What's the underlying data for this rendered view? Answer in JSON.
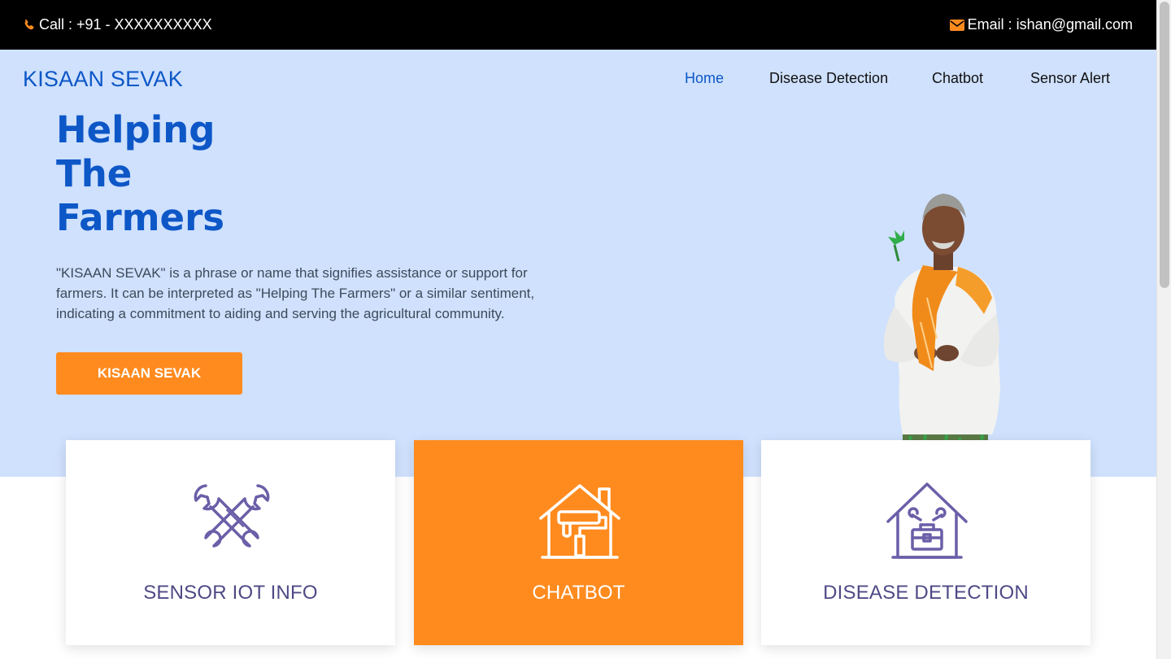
{
  "topbar": {
    "call_text": "Call : +91 - XXXXXXXXXX",
    "email_text": "Email : ishan@gmail.com",
    "phone_icon": "phone-icon",
    "mail_icon": "envelope-icon",
    "icon_color": "#ff8b1f"
  },
  "brand": "KISAAN SEVAK",
  "nav": {
    "items": [
      "Home",
      "Disease Detection",
      "Chatbot",
      "Sensor Alert"
    ],
    "active": "Home"
  },
  "hero": {
    "headline": [
      "Helping",
      "The",
      "Farmers"
    ],
    "description": "\"KISAAN SEVAK\" is a phrase or name that signifies assistance or support for farmers. It can be interpreted as \"Helping The Farmers\" or a similar sentiment, indicating a commitment to aiding and serving the agricultural community.",
    "cta_label": "KISAAN SEVAK"
  },
  "cards": [
    {
      "label": "SENSOR IOT INFO",
      "icon": "crossed-wrenches-icon"
    },
    {
      "label": "CHATBOT",
      "icon": "house-paint-roller-icon"
    },
    {
      "label": "DISEASE DETECTION",
      "icon": "house-toolbox-icon"
    }
  ],
  "colors": {
    "brand_blue": "#0d57c7",
    "hero_bg": "#cfe1fd",
    "accent_orange": "#ff8b1f",
    "icon_purple": "#6a5fa8"
  }
}
